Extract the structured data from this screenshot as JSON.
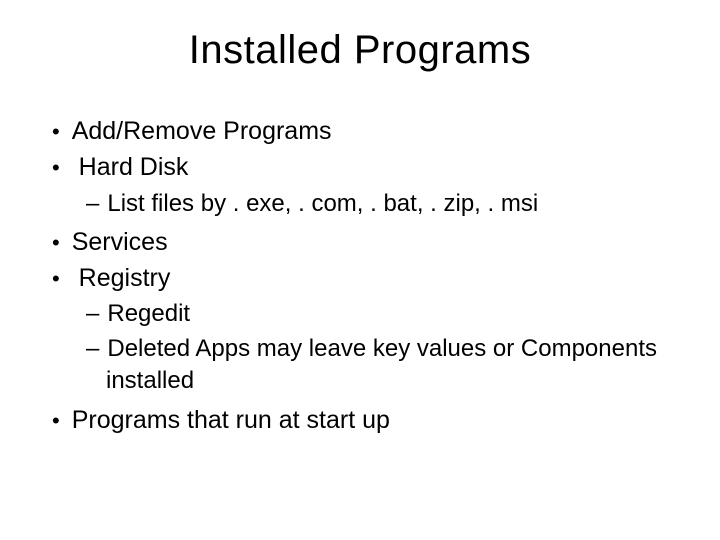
{
  "title": "Installed Programs",
  "items": {
    "addRemove": "Add/Remove Programs",
    "hardDisk": "Hard Disk",
    "hardDiskSub": {
      "listFiles": "List files by . exe, . com, . bat, . zip, . msi"
    },
    "services": "Services",
    "registry": "Registry",
    "registrySub": {
      "regedit": "Regedit",
      "deletedApps": "Deleted Apps may leave key values or Components installed"
    },
    "startup": "Programs that run at start up"
  }
}
